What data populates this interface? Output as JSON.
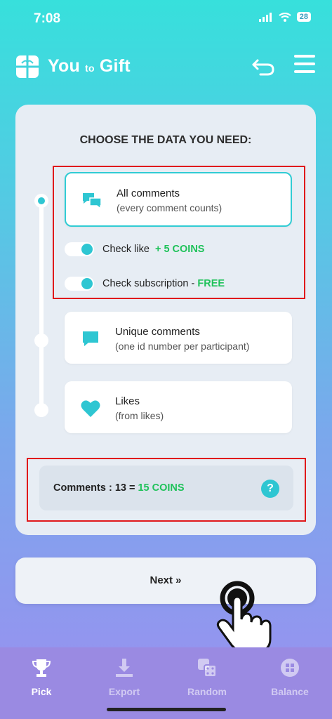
{
  "status": {
    "time": "7:08",
    "battery": "28"
  },
  "header": {
    "brand_main": "You",
    "brand_small": "to",
    "brand_end": "Gift"
  },
  "card": {
    "title": "CHOOSE THE DATA YOU NEED:",
    "options": [
      {
        "title": "All comments",
        "subtitle": "(every comment counts)"
      },
      {
        "title": "Unique comments",
        "subtitle": "(one id number per participant)"
      },
      {
        "title": "Likes",
        "subtitle": "(from likes)"
      }
    ],
    "toggles": [
      {
        "label": "Check like",
        "extra": "+ 5 COINS"
      },
      {
        "label": "Check subscription - ",
        "extra": "FREE"
      }
    ],
    "summary": {
      "label": "Comments : 13  = ",
      "coins": "15 COINS",
      "help": "?"
    }
  },
  "next_button": {
    "label": "Next »"
  },
  "tabs": [
    {
      "label": "Pick",
      "icon": "trophy-icon",
      "active": true
    },
    {
      "label": "Export",
      "icon": "download-icon",
      "active": false
    },
    {
      "label": "Random",
      "icon": "dice-icon",
      "active": false
    },
    {
      "label": "Balance",
      "icon": "coin-icon",
      "active": false
    }
  ],
  "colors": {
    "accent": "#2ec6d2",
    "coins_green": "#1fc25a",
    "highlight_red": "#e0191b"
  }
}
